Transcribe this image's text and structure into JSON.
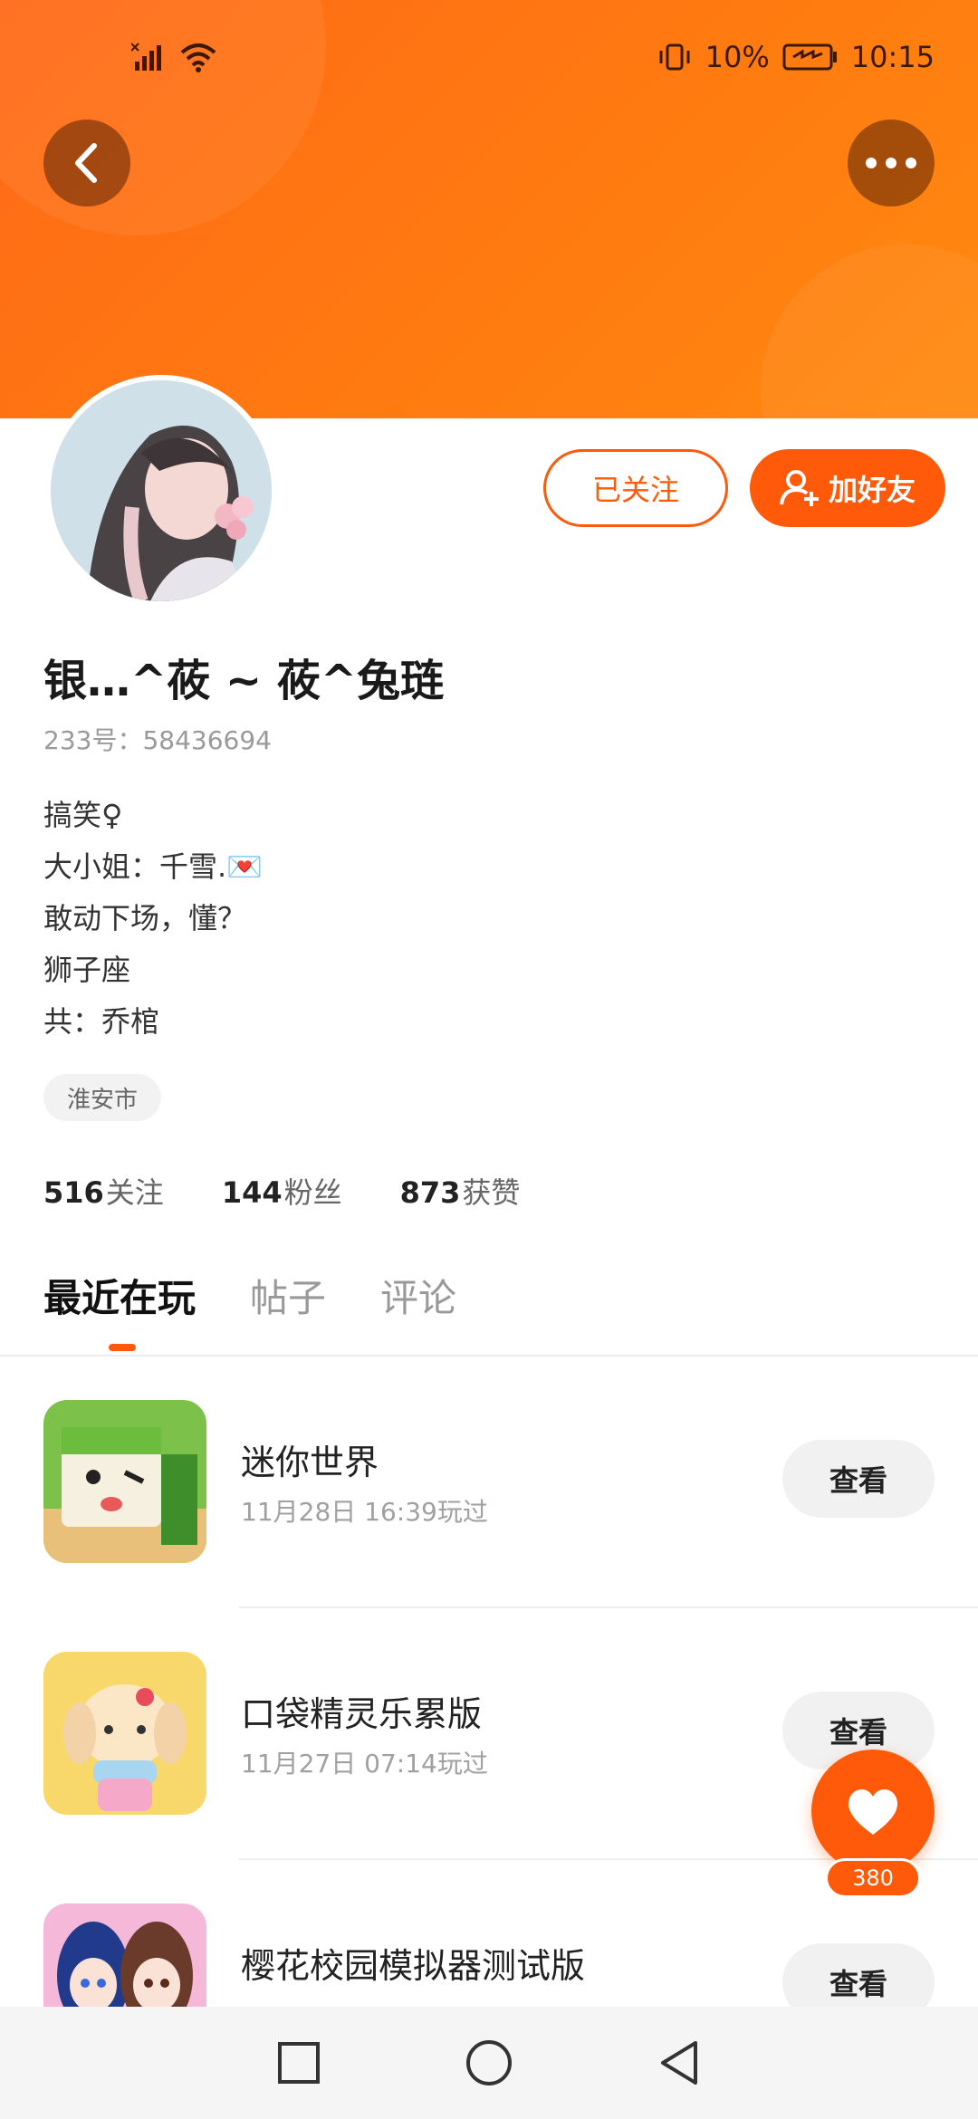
{
  "status_bar": {
    "battery_percent": "10%",
    "time": "10:15"
  },
  "header": {
    "back_icon": "chevron-left-icon",
    "more_icon": "more-horizontal-icon",
    "accent": "#ff6a18"
  },
  "profile": {
    "followed_label": "已关注",
    "add_friend_label": "加好友",
    "name": "银…^莜 ~ 莜^兔琏",
    "id_line": "233号：58436694",
    "bio": [
      "搞笑♀",
      "大小姐：千雪.💌",
      "敢动下场，懂？",
      "狮子座",
      "共：乔棺"
    ],
    "location_tag": "淮安市",
    "stats": [
      {
        "num": "516",
        "label": "关注"
      },
      {
        "num": "144",
        "label": "粉丝"
      },
      {
        "num": "873",
        "label": "获赞"
      }
    ]
  },
  "tabs": [
    "最近在玩",
    "帖子",
    "评论"
  ],
  "games": [
    {
      "title": "迷你世界",
      "played": "11月28日 16:39玩过",
      "view_label": "查看"
    },
    {
      "title": "口袋精灵乐累版",
      "played": "11月27日 07:14玩过",
      "view_label": "查看"
    },
    {
      "title": "樱花校园模拟器测试版",
      "played": "",
      "view_label": "查看"
    }
  ],
  "fab": {
    "count": "380",
    "icon": "heart-icon"
  }
}
